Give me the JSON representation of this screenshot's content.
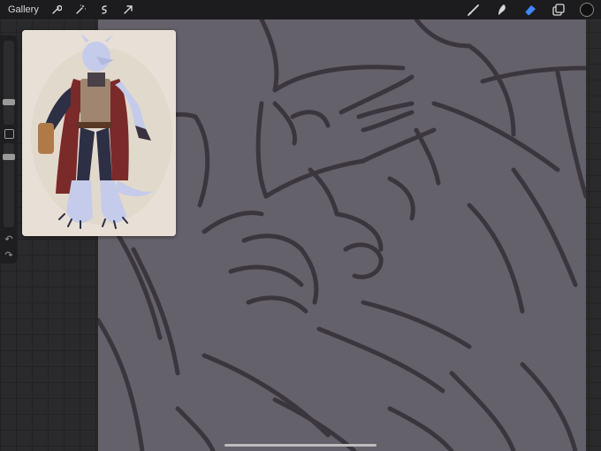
{
  "topbar": {
    "gallery_label": "Gallery",
    "left_tools": [
      {
        "name": "wrench-icon"
      },
      {
        "name": "magic-wand-icon"
      },
      {
        "name": "selection-icon"
      },
      {
        "name": "transform-arrow-icon"
      }
    ],
    "right_tools": [
      {
        "name": "brush-icon"
      },
      {
        "name": "smudge-icon"
      },
      {
        "name": "eraser-icon"
      },
      {
        "name": "layers-icon"
      }
    ],
    "active_tool": "eraser",
    "active_color": "#111111"
  },
  "sidebar": {
    "undo_glyph": "↶",
    "redo_glyph": "↷"
  },
  "colors": {
    "canvas": "#65616a",
    "stroke": "#3b363d",
    "accent": "#3f86ff"
  }
}
